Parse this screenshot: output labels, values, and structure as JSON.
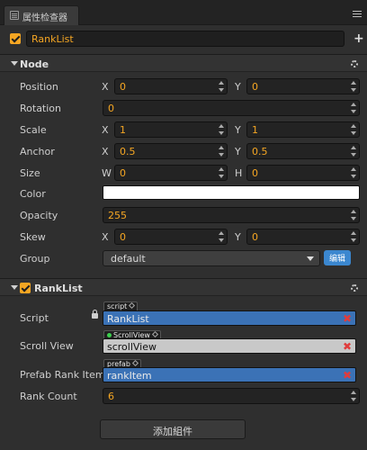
{
  "panel": {
    "tab_title": "属性检查器",
    "tab_icon": "list-icon",
    "menu_icon": "hamburger-menu-icon"
  },
  "node_name": {
    "value": "RankList",
    "enabled": true
  },
  "add_icon": "plus-icon",
  "sections": {
    "node": {
      "title": "Node"
    },
    "ranklist": {
      "title": "RankList",
      "enabled": true
    }
  },
  "props": {
    "position": {
      "label": "Position",
      "x_axis": "X",
      "x": "0",
      "y_axis": "Y",
      "y": "0"
    },
    "rotation": {
      "label": "Rotation",
      "value": "0"
    },
    "scale": {
      "label": "Scale",
      "x_axis": "X",
      "x": "1",
      "y_axis": "Y",
      "y": "1"
    },
    "anchor": {
      "label": "Anchor",
      "x_axis": "X",
      "x": "0.5",
      "y_axis": "Y",
      "y": "0.5"
    },
    "size": {
      "label": "Size",
      "w_axis": "W",
      "w": "0",
      "h_axis": "H",
      "h": "0"
    },
    "color": {
      "label": "Color",
      "value": "#ffffff"
    },
    "opacity": {
      "label": "Opacity",
      "value": "255"
    },
    "skew": {
      "label": "Skew",
      "x_axis": "X",
      "x": "0",
      "y_axis": "Y",
      "y": "0"
    },
    "group": {
      "label": "Group",
      "value": "default",
      "edit_label": "编辑"
    }
  },
  "component": {
    "script": {
      "label": "Script",
      "tag": "script",
      "value": "RankList"
    },
    "scroll_view": {
      "label": "Scroll View",
      "tag": "ScrollView",
      "value": "scrollView"
    },
    "prefab_rank_item": {
      "label": "Prefab Rank Item",
      "tag": "prefab",
      "value": "rankItem"
    },
    "rank_count": {
      "label": "Rank Count",
      "value": "6"
    }
  },
  "add_component_label": "添加組件",
  "colors": {
    "accent": "#f5a623",
    "blue": "#3b72b6",
    "edit_blue": "#3b87cf",
    "remove": "#e03c3c"
  }
}
